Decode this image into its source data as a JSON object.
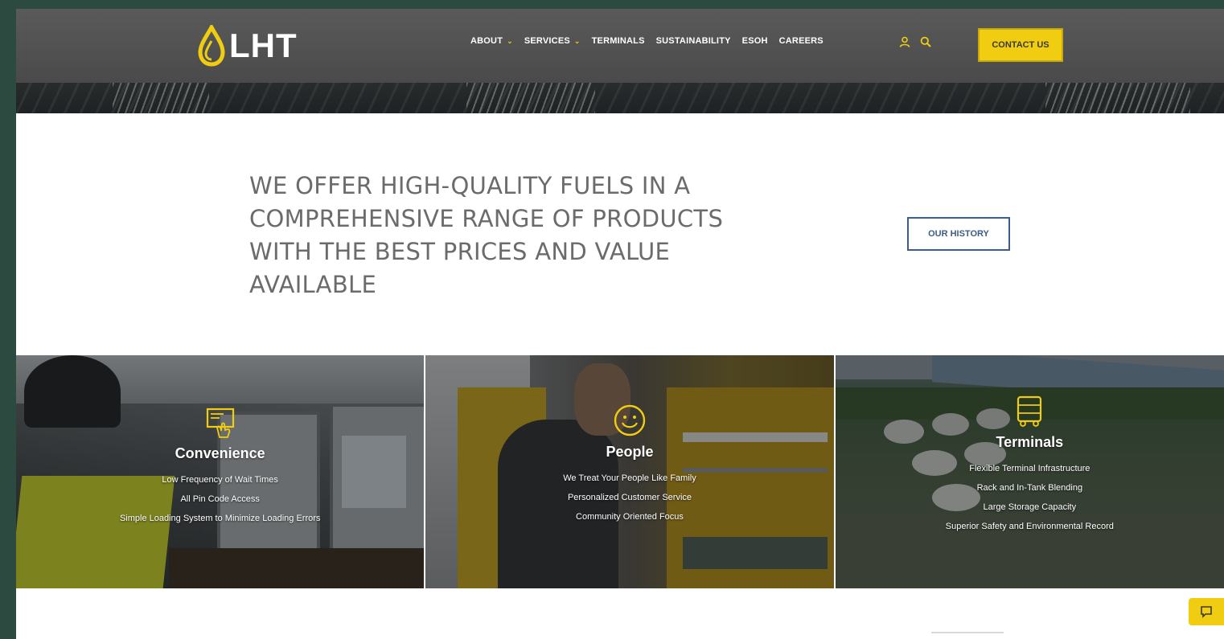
{
  "header": {
    "logo_text": "LHT",
    "nav": [
      {
        "label": "ABOUT",
        "has_dropdown": true
      },
      {
        "label": "SERVICES",
        "has_dropdown": true
      },
      {
        "label": "TERMINALS",
        "has_dropdown": false
      },
      {
        "label": "SUSTAINABILITY",
        "has_dropdown": false
      },
      {
        "label": "ESOH",
        "has_dropdown": false
      },
      {
        "label": "CAREERS",
        "has_dropdown": false
      }
    ],
    "icons": [
      "user-icon",
      "search-icon"
    ],
    "contact_label": "CONTACT US"
  },
  "intro": {
    "heading": "WE OFFER HIGH-QUALITY FUELS IN A COMPREHENSIVE RANGE OF PRODUCTS WITH THE BEST PRICES AND VALUE AVAILABLE",
    "history_label": "OUR HISTORY"
  },
  "features": [
    {
      "title": "Convenience",
      "icon": "touchscreen-icon",
      "items": [
        "Low Frequency of Wait Times",
        "All Pin Code Access",
        "Simple Loading System to Minimize Loading Errors"
      ]
    },
    {
      "title": "People",
      "icon": "smiley-icon",
      "items": [
        "We Treat Your People Like Family",
        "Personalized Customer Service",
        "Community Oriented Focus"
      ]
    },
    {
      "title": "Terminals",
      "icon": "tanker-truck-icon",
      "items": [
        "Flexible Terminal Infrastructure",
        "Rack and In-Tank Blending",
        "Large Storage Capacity",
        "Superior Safety and Environmental Record"
      ]
    }
  ],
  "colors": {
    "brand_yellow": "#f0cd10",
    "nav_bg": "#4a4a4a",
    "history_border": "#3b5d86",
    "heading_gray": "#6b6b6b"
  }
}
